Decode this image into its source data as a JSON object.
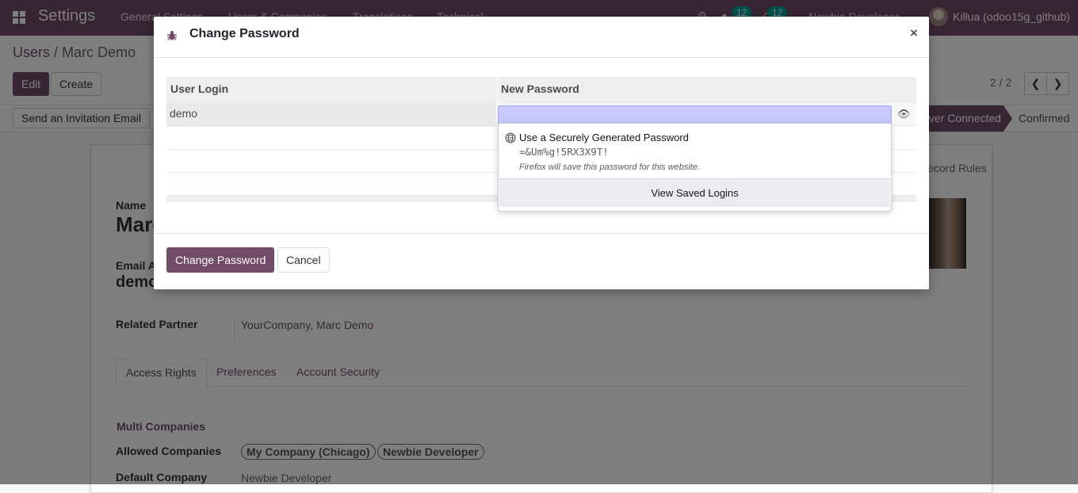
{
  "navbar": {
    "app_name": "Settings",
    "menus": [
      "General Settings",
      "Users & Companies",
      "Translations",
      "Technical"
    ],
    "messages_count": "12",
    "activities_count": "12",
    "company": "Newbie Developer",
    "user": "Killua (odoo15g_github)"
  },
  "control_panel": {
    "breadcrumb_parent": "Users",
    "breadcrumb_sep": "/",
    "breadcrumb_current": "Marc Demo",
    "edit_label": "Edit",
    "create_label": "Create",
    "pager": "2 / 2"
  },
  "statusbar": {
    "invite_label": "Send an Invitation Email",
    "stage_active": "Never Connected",
    "stage_confirmed": "Confirmed"
  },
  "form": {
    "record_rules_label": "Record Rules",
    "name_label": "Name",
    "name_value": "Marc Demo",
    "email_label": "Email Address",
    "email_value": "demo",
    "related_partner_label": "Related Partner",
    "related_partner_value": "YourCompany, Marc Demo",
    "tabs": [
      "Access Rights",
      "Preferences",
      "Account Security"
    ],
    "multi_companies_title": "Multi Companies",
    "allowed_companies_label": "Allowed Companies",
    "allowed_companies": [
      "My Company (Chicago)",
      "Newbie Developer"
    ],
    "default_company_label": "Default Company",
    "default_company_value": "Newbie Developer"
  },
  "dialog": {
    "title": "Change Password",
    "close": "×",
    "col_user_login": "User Login",
    "col_new_password": "New Password",
    "rows": [
      {
        "login": "demo",
        "new_password": ""
      }
    ],
    "autofill": {
      "title": "Use a Securely Generated Password",
      "password": "=&Um%g!5RX3X9T!",
      "note": "Firefox will save this password for this website.",
      "footer": "View Saved Logins"
    },
    "confirm_label": "Change Password",
    "cancel_label": "Cancel"
  },
  "colors": {
    "brand": "#714B67",
    "badge": "#00A09D",
    "autofill_bg": "#c8c8ff"
  }
}
